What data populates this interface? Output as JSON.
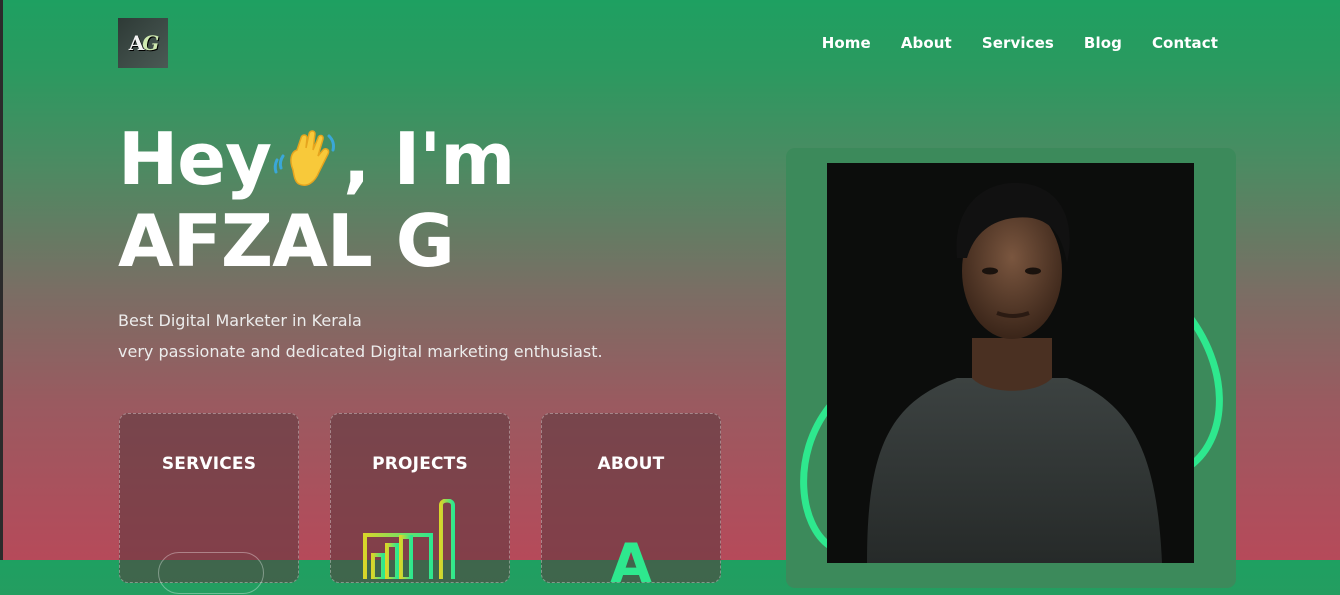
{
  "header": {
    "logo_text": "AG",
    "nav": [
      "Home",
      "About",
      "Services",
      "Blog",
      "Contact"
    ]
  },
  "hero": {
    "greeting_before": "Hey",
    "greeting_after": ", I'm",
    "name": "AFZAL G",
    "subtitle_line1": "Best Digital Marketer in Kerala",
    "subtitle_line2": "very passionate and dedicated Digital marketing enthusiast."
  },
  "cards": [
    {
      "title": "SERVICES",
      "icon": "pill-button-outline"
    },
    {
      "title": "PROJECTS",
      "icon": "bar-chart-icon"
    },
    {
      "title": "ABOUT",
      "icon": "letter-a-icon",
      "glyph": "A"
    }
  ],
  "colors": {
    "accent_green": "#2ee88e",
    "frame_green": "#3c8a5b",
    "bg_top": "#1ea061",
    "bg_bottom": "#b64a5a"
  },
  "icons": {
    "wave": "waving-hand-icon"
  }
}
